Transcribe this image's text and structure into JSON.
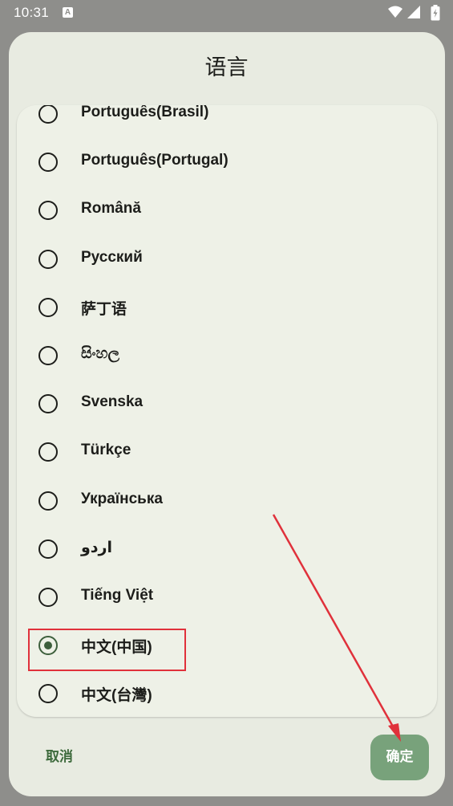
{
  "status_bar": {
    "time": "10:31",
    "notification_letter": "A"
  },
  "dialog": {
    "title": "语言",
    "languages": [
      {
        "label": "Português(Brasil)",
        "selected": false
      },
      {
        "label": "Português(Portugal)",
        "selected": false
      },
      {
        "label": "Română",
        "selected": false
      },
      {
        "label": "Русский",
        "selected": false
      },
      {
        "label": "萨丁语",
        "selected": false
      },
      {
        "label": "සිංහල",
        "selected": false
      },
      {
        "label": "Svenska",
        "selected": false
      },
      {
        "label": "Türkçe",
        "selected": false
      },
      {
        "label": "Українська",
        "selected": false
      },
      {
        "label": "اردو",
        "selected": false
      },
      {
        "label": "Tiếng Việt",
        "selected": false
      },
      {
        "label": "中文(中国)",
        "selected": true
      },
      {
        "label": "中文(台灣)",
        "selected": false
      }
    ],
    "cancel_label": "取消",
    "confirm_label": "确定"
  },
  "colors": {
    "accent": "#3d5f3c",
    "confirm_bg": "#78a27b",
    "annotation": "#e0313b"
  }
}
